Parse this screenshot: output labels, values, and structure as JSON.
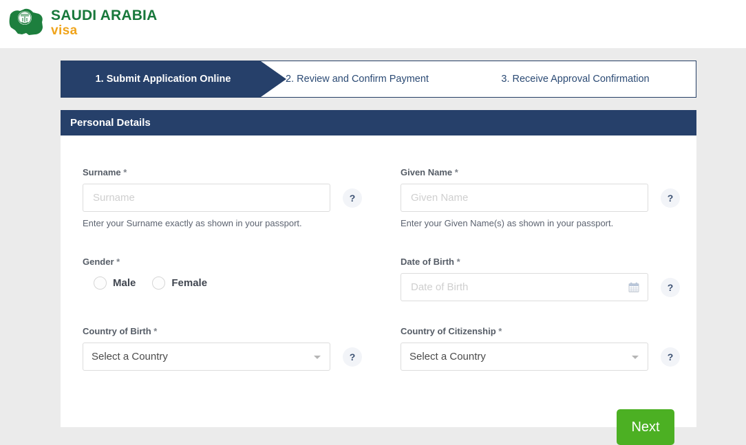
{
  "brand": {
    "line1": "SAUDI ARABIA",
    "line2": "visa",
    "logo_icon": "saudi-map-emblem-icon",
    "green": "#18783b",
    "amber": "#f0a41b"
  },
  "wizard": {
    "steps": [
      {
        "label": "1. Submit Application Online",
        "active": true
      },
      {
        "label": "2. Review and Confirm Payment",
        "active": false
      },
      {
        "label": "3. Receive Approval Confirmation",
        "active": false
      }
    ],
    "active_bg": "#26406a",
    "border": "#243d63"
  },
  "panel": {
    "title": "Personal Details",
    "header_bg": "#26406a"
  },
  "form": {
    "help_symbol": "?",
    "required_marker": "*",
    "surname": {
      "label": "Surname",
      "required_marker": "*",
      "value": "",
      "placeholder": "Surname",
      "hint": "Enter your Surname exactly as shown in your passport.",
      "help": "?"
    },
    "given_name": {
      "label": "Given Name",
      "required_marker": "*",
      "value": "",
      "placeholder": "Given Name",
      "hint": "Enter your Given Name(s) as shown in your passport.",
      "help": "?"
    },
    "gender": {
      "label": "Gender",
      "required_marker": "*",
      "options": [
        {
          "label": "Male",
          "selected": false
        },
        {
          "label": "Female",
          "selected": false
        }
      ]
    },
    "date_of_birth": {
      "label": "Date of Birth",
      "required_marker": "*",
      "value": "",
      "placeholder": "Date of Birth",
      "icon": "calendar-icon",
      "help": "?"
    },
    "country_of_birth": {
      "label": "Country of Birth",
      "required_marker": "*",
      "selected": "Select a Country",
      "caret": "chevron-down-icon",
      "help": "?"
    },
    "country_of_citizenship": {
      "label": "Country of Citizenship",
      "required_marker": "*",
      "selected": "Select a Country",
      "caret": "chevron-down-icon",
      "help": "?"
    },
    "next_button": "Next",
    "next_button_color": "#4cb023"
  }
}
